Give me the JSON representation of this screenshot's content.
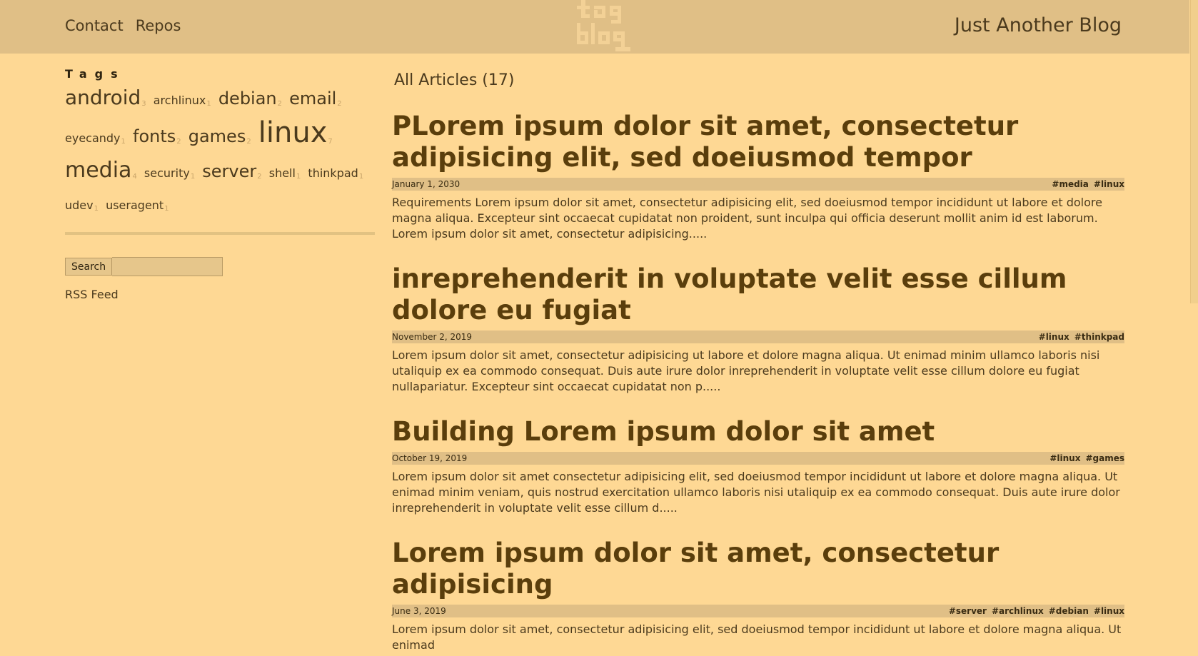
{
  "header": {
    "nav": [
      {
        "label": "Contact"
      },
      {
        "label": "Repos"
      }
    ],
    "logo_icon": "tag-blog-logo-icon",
    "site_title": "Just Another Blog"
  },
  "sidebar": {
    "tags_heading": "Tags",
    "tags": [
      {
        "name": "android",
        "count": "3",
        "size": "28px"
      },
      {
        "name": "archlinux",
        "count": "1",
        "size": "16px"
      },
      {
        "name": "debian",
        "count": "2",
        "size": "24px"
      },
      {
        "name": "email",
        "count": "2",
        "size": "24px"
      },
      {
        "name": "eyecandy",
        "count": "1",
        "size": "16px"
      },
      {
        "name": "fonts",
        "count": "2",
        "size": "24px"
      },
      {
        "name": "games",
        "count": "2",
        "size": "24px"
      },
      {
        "name": "linux",
        "count": "7",
        "size": "40px"
      },
      {
        "name": "media",
        "count": "4",
        "size": "30px"
      },
      {
        "name": "security",
        "count": "1",
        "size": "16px"
      },
      {
        "name": "server",
        "count": "2",
        "size": "24px"
      },
      {
        "name": "shell",
        "count": "1",
        "size": "16px"
      },
      {
        "name": "thinkpad",
        "count": "1",
        "size": "16px"
      },
      {
        "name": "udev",
        "count": "1",
        "size": "16px"
      },
      {
        "name": "useragent",
        "count": "1",
        "size": "16px"
      }
    ],
    "search_button": "Search",
    "search_placeholder": "",
    "rss_label": "RSS Feed"
  },
  "main": {
    "heading": "All Articles (17)",
    "articles": [
      {
        "title": "PLorem ipsum dolor sit amet, consectetur adipisicing elit, sed doeiusmod tempor",
        "date": "January 1, 2030",
        "tags": [
          "#media",
          "#linux"
        ],
        "excerpt": "Requirements Lorem ipsum dolor sit amet, consectetur adipisicing elit, sed doeiusmod tempor incididunt ut labore et dolore magna aliqua. Excepteur sint occaecat cupidatat non proident, sunt inculpa qui officia deserunt mollit anim id est laborum. Lorem ipsum dolor sit amet, consectetur adipisicing....."
      },
      {
        "title": "inreprehenderit in voluptate velit esse cillum dolore eu fugiat",
        "date": "November 2, 2019",
        "tags": [
          "#linux",
          "#thinkpad"
        ],
        "excerpt": "Lorem ipsum dolor sit amet, consectetur adipisicing ut labore et dolore magna aliqua. Ut enimad minim ullamco laboris nisi utaliquip ex ea commodo consequat. Duis aute irure dolor inreprehenderit in voluptate velit esse cillum dolore eu fugiat nullapariatur. Excepteur sint occaecat cupidatat non p....."
      },
      {
        "title": "Building Lorem ipsum dolor sit amet",
        "date": "October 19, 2019",
        "tags": [
          "#linux",
          "#games"
        ],
        "excerpt": "Lorem ipsum dolor sit amet consectetur adipisicing elit, sed doeiusmod tempor incididunt ut labore et dolore magna aliqua. Ut enimad minim veniam, quis nostrud exercitation ullamco laboris nisi utaliquip ex ea commodo consequat. Duis aute irure dolor inreprehenderit in voluptate velit esse cillum d....."
      },
      {
        "title": "Lorem ipsum dolor sit amet, consectetur adipisicing",
        "date": "June 3, 2019",
        "tags": [
          "#server",
          "#archlinux",
          "#debian",
          "#linux"
        ],
        "excerpt": "Lorem ipsum dolor sit amet, consectetur adipisicing elit, sed doeiusmod tempor incididunt ut labore et dolore magna aliqua. Ut enimad"
      }
    ]
  },
  "colors": {
    "background": "#fed894",
    "header": "#e0bf86",
    "title": "#5a3e0c",
    "text": "#4b3a1d"
  }
}
